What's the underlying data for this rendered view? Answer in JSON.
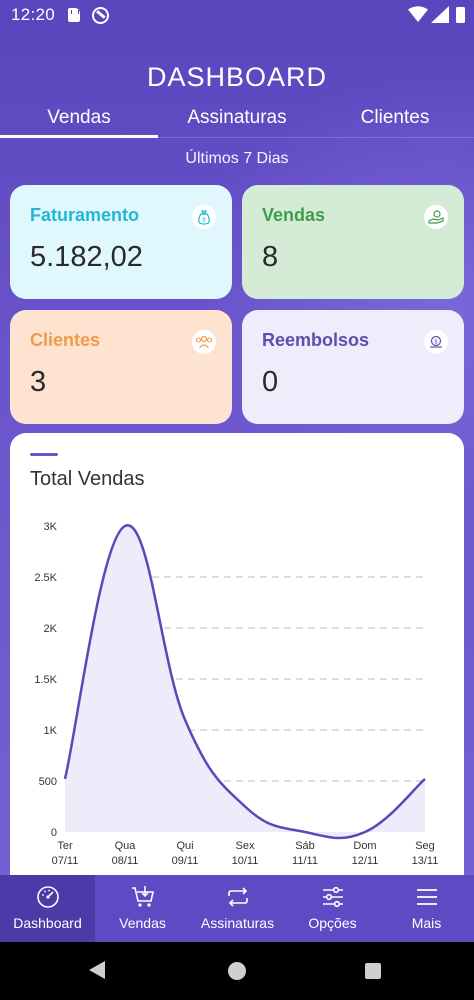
{
  "status_bar": {
    "time": "12:20"
  },
  "header": {
    "title": "DASHBOARD"
  },
  "tabs": [
    {
      "label": "Vendas",
      "active": true
    },
    {
      "label": "Assinaturas",
      "active": false
    },
    {
      "label": "Clientes",
      "active": false
    }
  ],
  "period_label": "Últimos 7 Dias",
  "cards": [
    {
      "label": "Faturamento",
      "value": "5.182,02",
      "icon": "money-bag-icon",
      "accent": "#22b7d4"
    },
    {
      "label": "Vendas",
      "value": "8",
      "icon": "hand-coin-icon",
      "accent": "#3f9d4a"
    },
    {
      "label": "Clientes",
      "value": "3",
      "icon": "people-icon",
      "accent": "#ef9c4a"
    },
    {
      "label": "Reembolsos",
      "value": "0",
      "icon": "refund-icon",
      "accent": "#5c4eae"
    }
  ],
  "chart": {
    "title": "Total Vendas"
  },
  "chart_data": {
    "type": "area",
    "categories": [
      [
        "Ter",
        "07/11"
      ],
      [
        "Qua",
        "08/11"
      ],
      [
        "Qui",
        "09/11"
      ],
      [
        "Sex",
        "10/11"
      ],
      [
        "Sáb",
        "11/11"
      ],
      [
        "Dom",
        "12/11"
      ],
      [
        "Seg",
        "13/11"
      ]
    ],
    "values": [
      520,
      3000,
      1100,
      250,
      0,
      0,
      520
    ],
    "yticks": [
      "0",
      "500",
      "1K",
      "1.5K",
      "2K",
      "2.5K",
      "3K"
    ],
    "ytick_values": [
      0,
      500,
      1000,
      1500,
      2000,
      2500,
      3000
    ],
    "ylim": [
      0,
      3000
    ],
    "grid": true,
    "line_color": "#5b48b8",
    "fill_color": "#efebfb"
  },
  "bottom_nav": [
    {
      "label": "Dashboard",
      "icon": "gauge-icon",
      "active": true
    },
    {
      "label": "Vendas",
      "icon": "cart-icon",
      "active": false
    },
    {
      "label": "Assinaturas",
      "icon": "repeat-icon",
      "active": false
    },
    {
      "label": "Opções",
      "icon": "sliders-icon",
      "active": false
    },
    {
      "label": "Mais",
      "icon": "menu-icon",
      "active": false
    }
  ],
  "colors": {
    "primary": "#6a55cc",
    "primary_dark": "#4d3aa8"
  }
}
